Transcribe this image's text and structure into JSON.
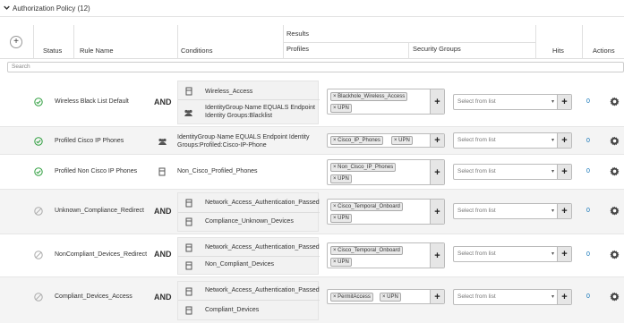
{
  "section": {
    "title": "Authorization Policy (12)",
    "chevron_icon": "chevron-down-icon"
  },
  "header": {
    "add_label": "+",
    "status": "Status",
    "rule_name": "Rule Name",
    "conditions": "Conditions",
    "results": "Results",
    "profiles": "Profiles",
    "security_groups": "Security Groups",
    "hits": "Hits",
    "actions": "Actions"
  },
  "search": {
    "placeholder": "Search"
  },
  "common": {
    "select_from_list": "Select from list",
    "plus": "+",
    "caret": "▾"
  },
  "colors": {
    "enabled_green": "#2e9e3e",
    "disabled_grey": "#aaaaaa",
    "hits_blue": "#0a6fb5"
  },
  "rules": [
    {
      "status": "enabled",
      "name": "Wireless Black List Default",
      "operator": "AND",
      "conditions": [
        {
          "icon": "condition-icon",
          "text": "Wireless_Access"
        },
        {
          "icon": "identity-group-icon",
          "text": "IdentityGroup·Name  EQUALS  Endpoint Identity Groups:Blacklist"
        }
      ],
      "profiles": [
        "Blackhole_Wireless_Access",
        "UPN"
      ],
      "hits": "0"
    },
    {
      "status": "enabled",
      "name": "Profiled Cisco IP Phones",
      "operator": "",
      "conditions": [
        {
          "icon": "identity-group-icon",
          "text": "IdentityGroup·Name  EQUALS  Endpoint Identity Groups:Profiled:Cisco-IP-Phone"
        }
      ],
      "profiles": [
        "Cisco_IP_Phones",
        "UPN"
      ],
      "hits": "0"
    },
    {
      "status": "enabled",
      "name": "Profiled Non Cisco IP Phones",
      "operator": "",
      "conditions": [
        {
          "icon": "condition-icon",
          "text": "Non_Cisco_Profiled_Phones"
        }
      ],
      "profiles": [
        "Non_Cisco_IP_Phones",
        "UPN"
      ],
      "hits": "0"
    },
    {
      "status": "disabled",
      "name": "Unknown_Compliance_Redirect",
      "operator": "AND",
      "conditions": [
        {
          "icon": "condition-icon",
          "text": "Network_Access_Authentication_Passed"
        },
        {
          "icon": "condition-icon",
          "text": "Compliance_Unknown_Devices"
        }
      ],
      "profiles": [
        "Cisco_Temporal_Onboard",
        "UPN"
      ],
      "hits": "0"
    },
    {
      "status": "disabled",
      "name": "NonCompliant_Devices_Redirect",
      "operator": "AND",
      "conditions": [
        {
          "icon": "condition-icon",
          "text": "Network_Access_Authentication_Passed"
        },
        {
          "icon": "condition-icon",
          "text": "Non_Compliant_Devices"
        }
      ],
      "profiles": [
        "Cisco_Temporal_Onboard",
        "UPN"
      ],
      "hits": "0"
    },
    {
      "status": "disabled",
      "name": "Compliant_Devices_Access",
      "operator": "AND",
      "conditions": [
        {
          "icon": "condition-icon",
          "text": "Network_Access_Authentication_Passed"
        },
        {
          "icon": "condition-icon",
          "text": "Compliant_Devices"
        }
      ],
      "profiles": [
        "PermitAccess",
        "UPN"
      ],
      "hits": "0"
    }
  ]
}
